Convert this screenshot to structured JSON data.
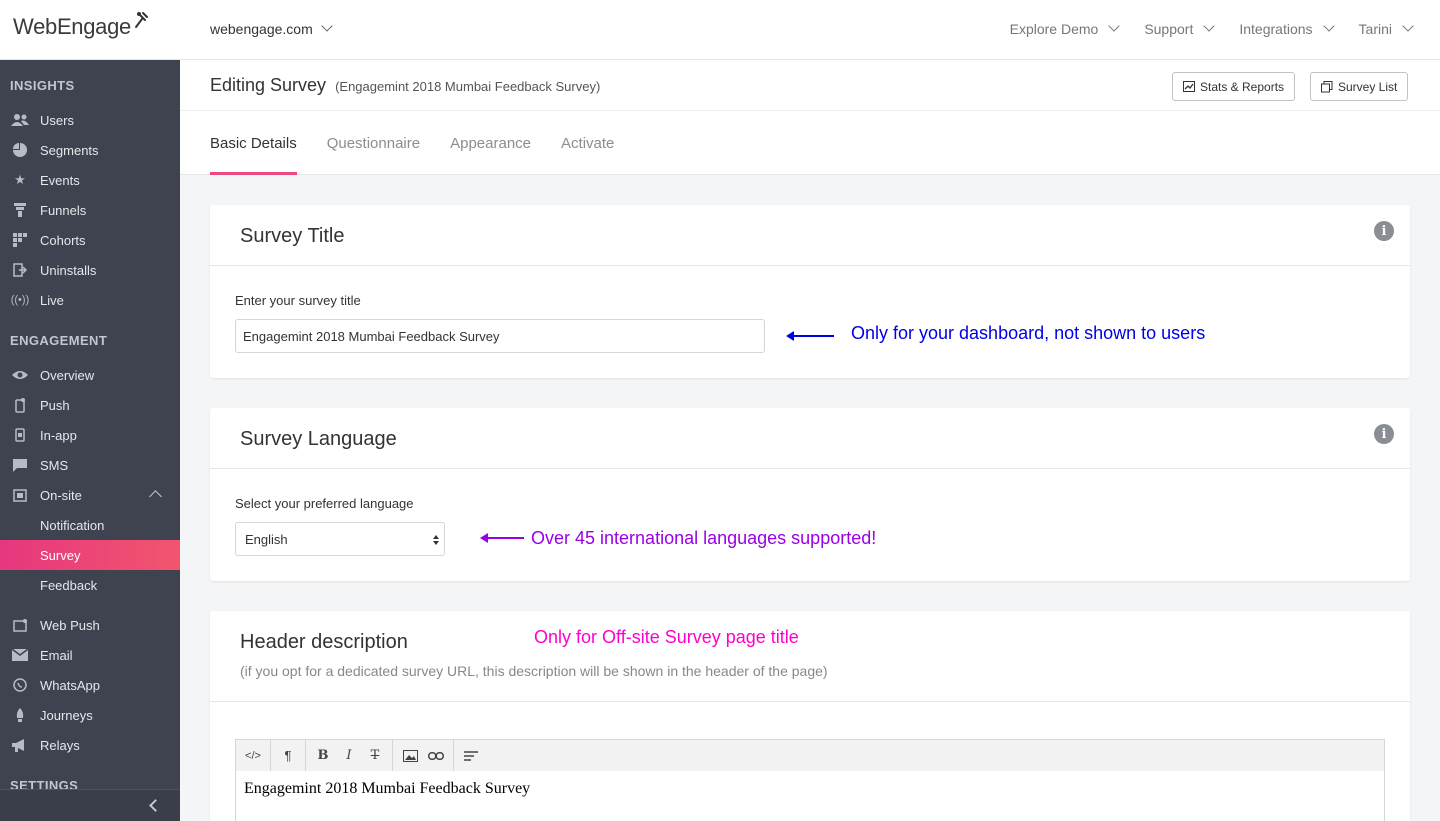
{
  "brand": {
    "logo_text": "WebEngage"
  },
  "topbar": {
    "domain": "webengage.com",
    "nav": [
      "Explore Demo",
      "Support",
      "Integrations",
      "Tarini"
    ]
  },
  "sidebar": {
    "sections": [
      {
        "title": "INSIGHTS",
        "items": [
          {
            "label": "Users",
            "icon": "users-icon"
          },
          {
            "label": "Segments",
            "icon": "pie-icon"
          },
          {
            "label": "Events",
            "icon": "star-icon"
          },
          {
            "label": "Funnels",
            "icon": "funnel-icon"
          },
          {
            "label": "Cohorts",
            "icon": "grid-icon"
          },
          {
            "label": "Uninstalls",
            "icon": "exit-icon"
          },
          {
            "label": "Live",
            "icon": "broadcast-icon"
          }
        ]
      },
      {
        "title": "ENGAGEMENT",
        "items": [
          {
            "label": "Overview",
            "icon": "eye-icon"
          },
          {
            "label": "Push",
            "icon": "mobile-icon"
          },
          {
            "label": "In-app",
            "icon": "phone-icon"
          },
          {
            "label": "SMS",
            "icon": "chat-icon"
          },
          {
            "label": "On-site",
            "icon": "window-icon"
          },
          {
            "label": "Notification"
          },
          {
            "label": "Survey"
          },
          {
            "label": "Feedback"
          },
          {
            "label": "Web Push",
            "icon": "browser-icon"
          },
          {
            "label": "Email",
            "icon": "mail-icon"
          },
          {
            "label": "WhatsApp",
            "icon": "whatsapp-icon"
          },
          {
            "label": "Journeys",
            "icon": "rocket-icon"
          },
          {
            "label": "Relays",
            "icon": "megaphone-icon"
          }
        ]
      },
      {
        "title": "SETTINGS",
        "items": []
      }
    ],
    "active_item": "Survey",
    "accent": "#e6377e"
  },
  "page": {
    "title": "Editing Survey",
    "subtitle": "(Engagemint 2018 Mumbai Feedback Survey)",
    "buttons": {
      "stats": "Stats & Reports",
      "list": "Survey List"
    },
    "tabs": [
      "Basic Details",
      "Questionnaire",
      "Appearance",
      "Activate"
    ],
    "active_tab": "Basic Details"
  },
  "survey_title_card": {
    "title": "Survey Title",
    "label": "Enter your survey title",
    "value": "Engagemint 2018 Mumbai Feedback Survey",
    "annotation": "Only for your dashboard, not shown to users",
    "annotation_color": "#0000e6"
  },
  "language_card": {
    "title": "Survey Language",
    "label": "Select your preferred language",
    "value": "English",
    "annotation": "Over 45 international languages supported!",
    "annotation_color": "#9a00e6"
  },
  "header_card": {
    "title": "Header description",
    "annotation": "Only for Off-site Survey page title",
    "annotation_color": "#ff00cc",
    "hint": "(if you opt for a dedicated survey URL, this description will be shown in the header of the page)",
    "toolbar": {
      "code": "</>",
      "paragraph": "¶",
      "bold": "B",
      "italic": "I",
      "strike": "T"
    },
    "content": "Engagemint 2018 Mumbai Feedback Survey"
  }
}
